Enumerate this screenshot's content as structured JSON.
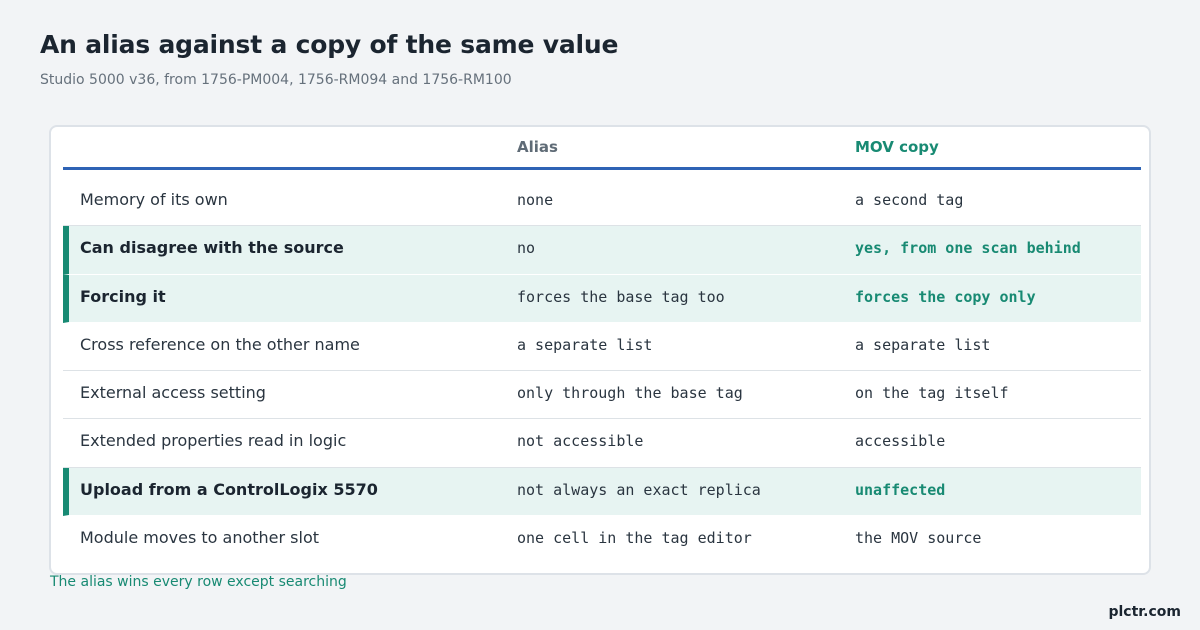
{
  "title": "An alias against a copy of the same value",
  "subtitle": "Studio 5000 v36, from 1756-PM004, 1756-RM094 and 1756-RM100",
  "table": {
    "headers": [
      "",
      "Alias",
      "MOV copy"
    ],
    "rows": [
      {
        "label": "Memory of its own",
        "alias": "none",
        "mov": "a second tag",
        "highlight": false
      },
      {
        "label": "Can disagree with the source",
        "alias": "no",
        "mov": "yes, from one scan behind",
        "highlight": true
      },
      {
        "label": "Forcing it",
        "alias": "forces the base tag too",
        "mov": "forces the copy only",
        "highlight": true
      },
      {
        "label": "Cross reference on the other name",
        "alias": "a separate list",
        "mov": "a separate list",
        "highlight": false
      },
      {
        "label": "External access setting",
        "alias": "only through the base tag",
        "mov": "on the tag itself",
        "highlight": false
      },
      {
        "label": "Extended properties read in logic",
        "alias": "not accessible",
        "mov": "accessible",
        "highlight": false
      },
      {
        "label": "Upload from a ControlLogix 5570",
        "alias": "not always an exact replica",
        "mov": "unaffected",
        "highlight": true
      },
      {
        "label": "Module moves to another slot",
        "alias": "one cell in the tag editor",
        "mov": "the MOV source",
        "highlight": false
      }
    ]
  },
  "footnote": "The alias wins every row except searching",
  "brand": "plctr.com",
  "colors": {
    "accent": "#188a73",
    "header_rule": "#2e63b5",
    "highlight_bg": "#e7f4f2",
    "page_bg": "#f2f4f6"
  }
}
